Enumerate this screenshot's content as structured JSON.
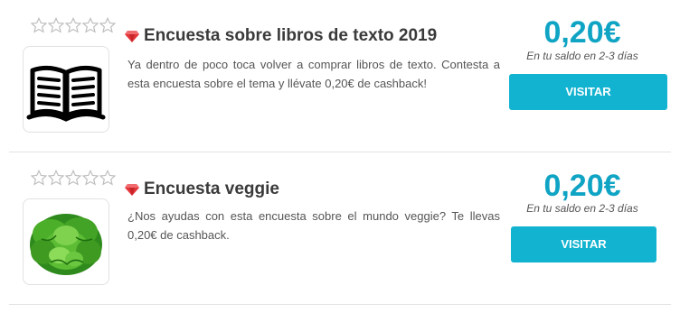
{
  "offers": [
    {
      "title": "Encuesta sobre libros de texto 2019",
      "description": "Ya dentro de poco toca volver a comprar libros de texto. Contesta a esta encuesta sobre el tema y llévate 0,20€ de cashback!",
      "price": "0,20€",
      "saldo_note": "En tu saldo en 2-3 días",
      "button_label": "VISITAR",
      "rating": 0,
      "rating_max": 5,
      "image": "open-book-icon"
    },
    {
      "title": "Encuesta veggie",
      "description": "¿Nos ayudas con esta encuesta sobre el mundo veggie? Te llevas 0,20€ de cashback.",
      "price": "0,20€",
      "saldo_note": "En tu saldo en 2-3 días",
      "button_label": "VISITAR",
      "rating": 0,
      "rating_max": 5,
      "image": "lettuce-image"
    }
  ],
  "colors": {
    "accent": "#12b3d1",
    "price": "#10a4c4",
    "gem": "#e2363b"
  }
}
